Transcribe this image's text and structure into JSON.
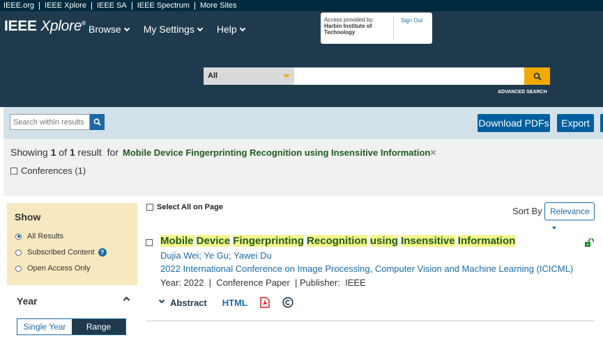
{
  "topbar": {
    "links": [
      "IEEE.org",
      "IEEE Xplore",
      "IEEE SA",
      "IEEE Spectrum",
      "More Sites"
    ]
  },
  "logo": {
    "main": "IEEE",
    "brand": "Xplore",
    "mark": "®"
  },
  "nav": {
    "items": [
      "Browse",
      "My Settings",
      "Help"
    ]
  },
  "access": {
    "label": "Access provided by:",
    "institution": "Harbin Institute of Technology",
    "signout": "Sign Out"
  },
  "search": {
    "scope": "All",
    "value": "",
    "advanced": "ADVANCED SEARCH"
  },
  "toolbar": {
    "within_placeholder": "Search within results",
    "download": "Download PDFs",
    "export": "Export"
  },
  "results": {
    "showing_prefix": "Showing",
    "from": "1",
    "of": "of",
    "total": "1",
    "result_word": "result",
    "for": "for",
    "query": "Mobile Device Fingerprinting Recognition using Insensitive Information",
    "clear": "×"
  },
  "filters": {
    "conferences": "Conferences (1)"
  },
  "show": {
    "title": "Show",
    "options": [
      "All Results",
      "Subscribed Content",
      "Open Access Only"
    ],
    "help": "?"
  },
  "year": {
    "title": "Year",
    "single": "Single Year",
    "range": "Range"
  },
  "list": {
    "select_all": "Select All on Page",
    "sort_label": "Sort By",
    "sort_value": "Relevance"
  },
  "item": {
    "title_words": [
      "Mobile",
      "Device",
      "Fingerprinting",
      "Recognition",
      "using",
      "Insensitive",
      "Information"
    ],
    "authors": "Dujia Wei; Ye Gu; Yawei Du",
    "venue": "2022 International Conference on Image Processing, Computer Vision and Machine Learning (ICICML)",
    "year_label": "Year:",
    "year": "2022",
    "type": "Conference Paper",
    "publisher_label": "Publisher:",
    "publisher": "IEEE",
    "abstract": "Abstract",
    "html": "HTML"
  },
  "colors": {
    "header": "#1f3a4d",
    "topbar": "#002a3d",
    "accent": "#f2a900",
    "link": "#1a6aa6",
    "title_green": "#1e5c1e",
    "highlight": "#f5f58a"
  }
}
